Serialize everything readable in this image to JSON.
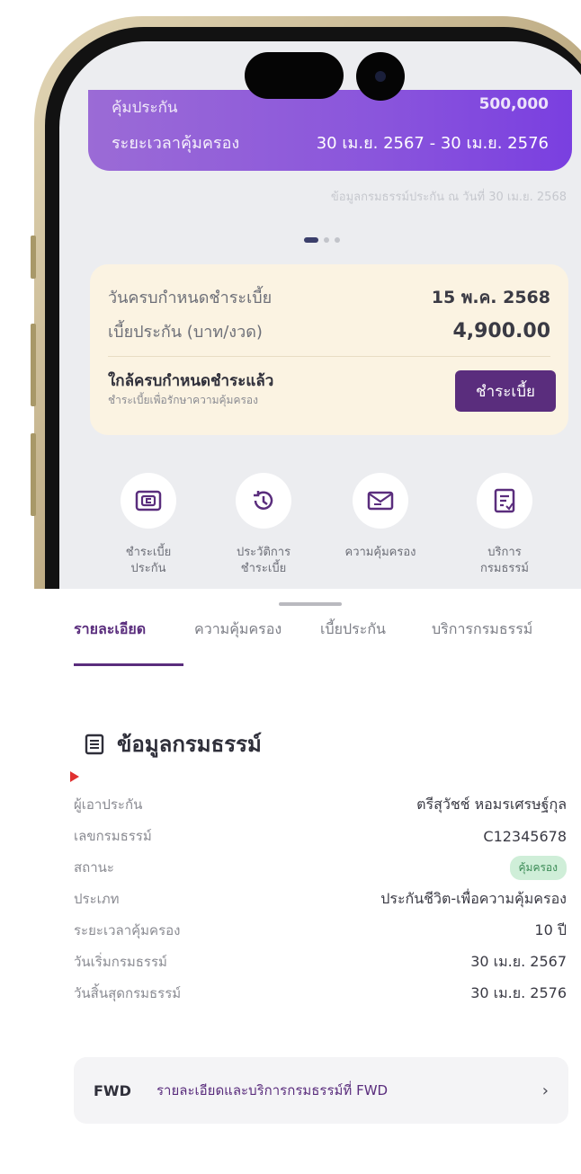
{
  "policy_card": {
    "top_label": "คุ้มประกัน",
    "top_value": "500,000",
    "period_label": "ระยะเวลาคุ้มครอง",
    "period_value": "30 เม.ย. 2567 - 30 เม.ย. 2576"
  },
  "as_of_text": "ข้อมูลกรมธรรม์ประกัน ณ วันที่ 30 เม.ย. 2568",
  "carousel": {
    "count": 3,
    "active_index": 0
  },
  "due": {
    "due_date_label": "วันครบกำหนดชำระเบี้ย",
    "due_date_value": "15 พ.ค. 2568",
    "premium_label": "เบี้ยประกัน (บาท/งวด)",
    "premium_value": "4,900.00",
    "near_title": "ใกล้ครบกำหนดชำระแล้ว",
    "near_sub": "ชำระเบี้ยเพื่อรักษาความคุ้มครอง",
    "pay_button": "ชำระเบี้ย"
  },
  "quick_actions": [
    {
      "icon": "wallet-icon",
      "line1": "ชำระเบี้ย",
      "line2": "ประกัน"
    },
    {
      "icon": "history-icon",
      "line1": "ประวัติการ",
      "line2": "ชำระเบี้ย"
    },
    {
      "icon": "mail-icon",
      "line1": "ความคุ้มครอง",
      "line2": ""
    },
    {
      "icon": "document-icon",
      "line1": "บริการ",
      "line2": "กรมธรรม์"
    }
  ],
  "tabs": [
    "รายละเอียด",
    "ความคุ้มครอง",
    "เบี้ยประกัน",
    "บริการกรมธรรม์"
  ],
  "active_tab": 0,
  "section_title": "ข้อมูลกรมธรรม์",
  "details": [
    {
      "label": "ผู้เอาประกัน",
      "value": "ตรีสุวัชช์ หอมรเศรษฐ์กุล"
    },
    {
      "label": "เลขกรมธรรม์",
      "value": "C12345678"
    },
    {
      "label": "สถานะ",
      "value": "คุ้มครอง"
    },
    {
      "label": "ประเภท",
      "value": "ประกันชีวิต-เพื่อความคุ้มครอง"
    },
    {
      "label": "ระยะเวลาคุ้มครอง",
      "value": "10 ปี"
    },
    {
      "label": "วันเริ่มกรมธรรม์",
      "value": "30 เม.ย. 2567"
    },
    {
      "label": "วันสิ้นสุดกรมธรรม์",
      "value": "30 เม.ย. 2576"
    }
  ],
  "fwd_bar": {
    "logo": "FWD",
    "text": "รายละเอียดและบริการกรมธรรม์ที่ FWD",
    "chevron": "›"
  },
  "colors": {
    "brand_purple": "#5a2d7d",
    "card_gradient_end": "#7a3fe0",
    "status_green": "#3a8a55"
  }
}
